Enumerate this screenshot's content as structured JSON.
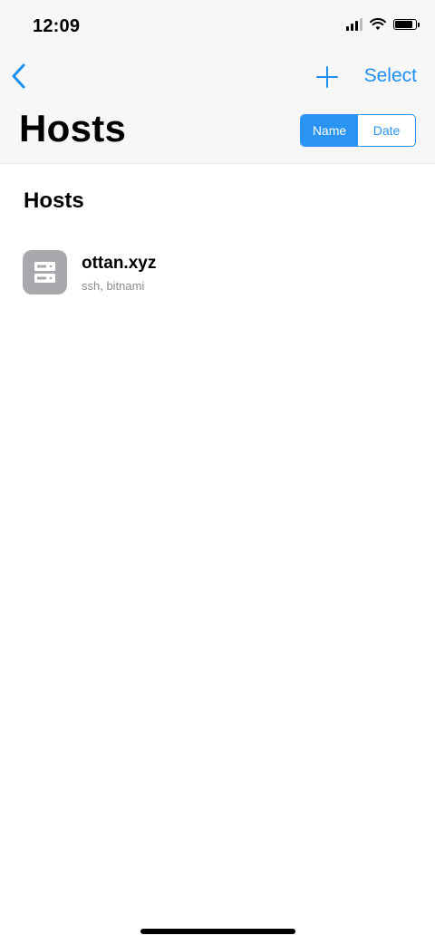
{
  "status_bar": {
    "time": "12:09",
    "icons": [
      "cellular-signal-icon",
      "wifi-icon",
      "battery-icon"
    ]
  },
  "nav": {
    "back_icon": "chevron-left-icon",
    "add_icon": "plus-icon",
    "select_label": "Select",
    "title": "Hosts"
  },
  "sort_control": {
    "options": [
      "Name",
      "Date"
    ],
    "selected": "Name"
  },
  "section": {
    "header": "Hosts"
  },
  "hosts": [
    {
      "name": "ottan.xyz",
      "details": "ssh, bitnami",
      "icon": "server-icon"
    }
  ],
  "colors": {
    "accent": "#1e8ef0",
    "nav_background": "#f7f7f7",
    "host_icon_bg": "#a7a9ac",
    "secondary_text": "#8a8a8a"
  }
}
